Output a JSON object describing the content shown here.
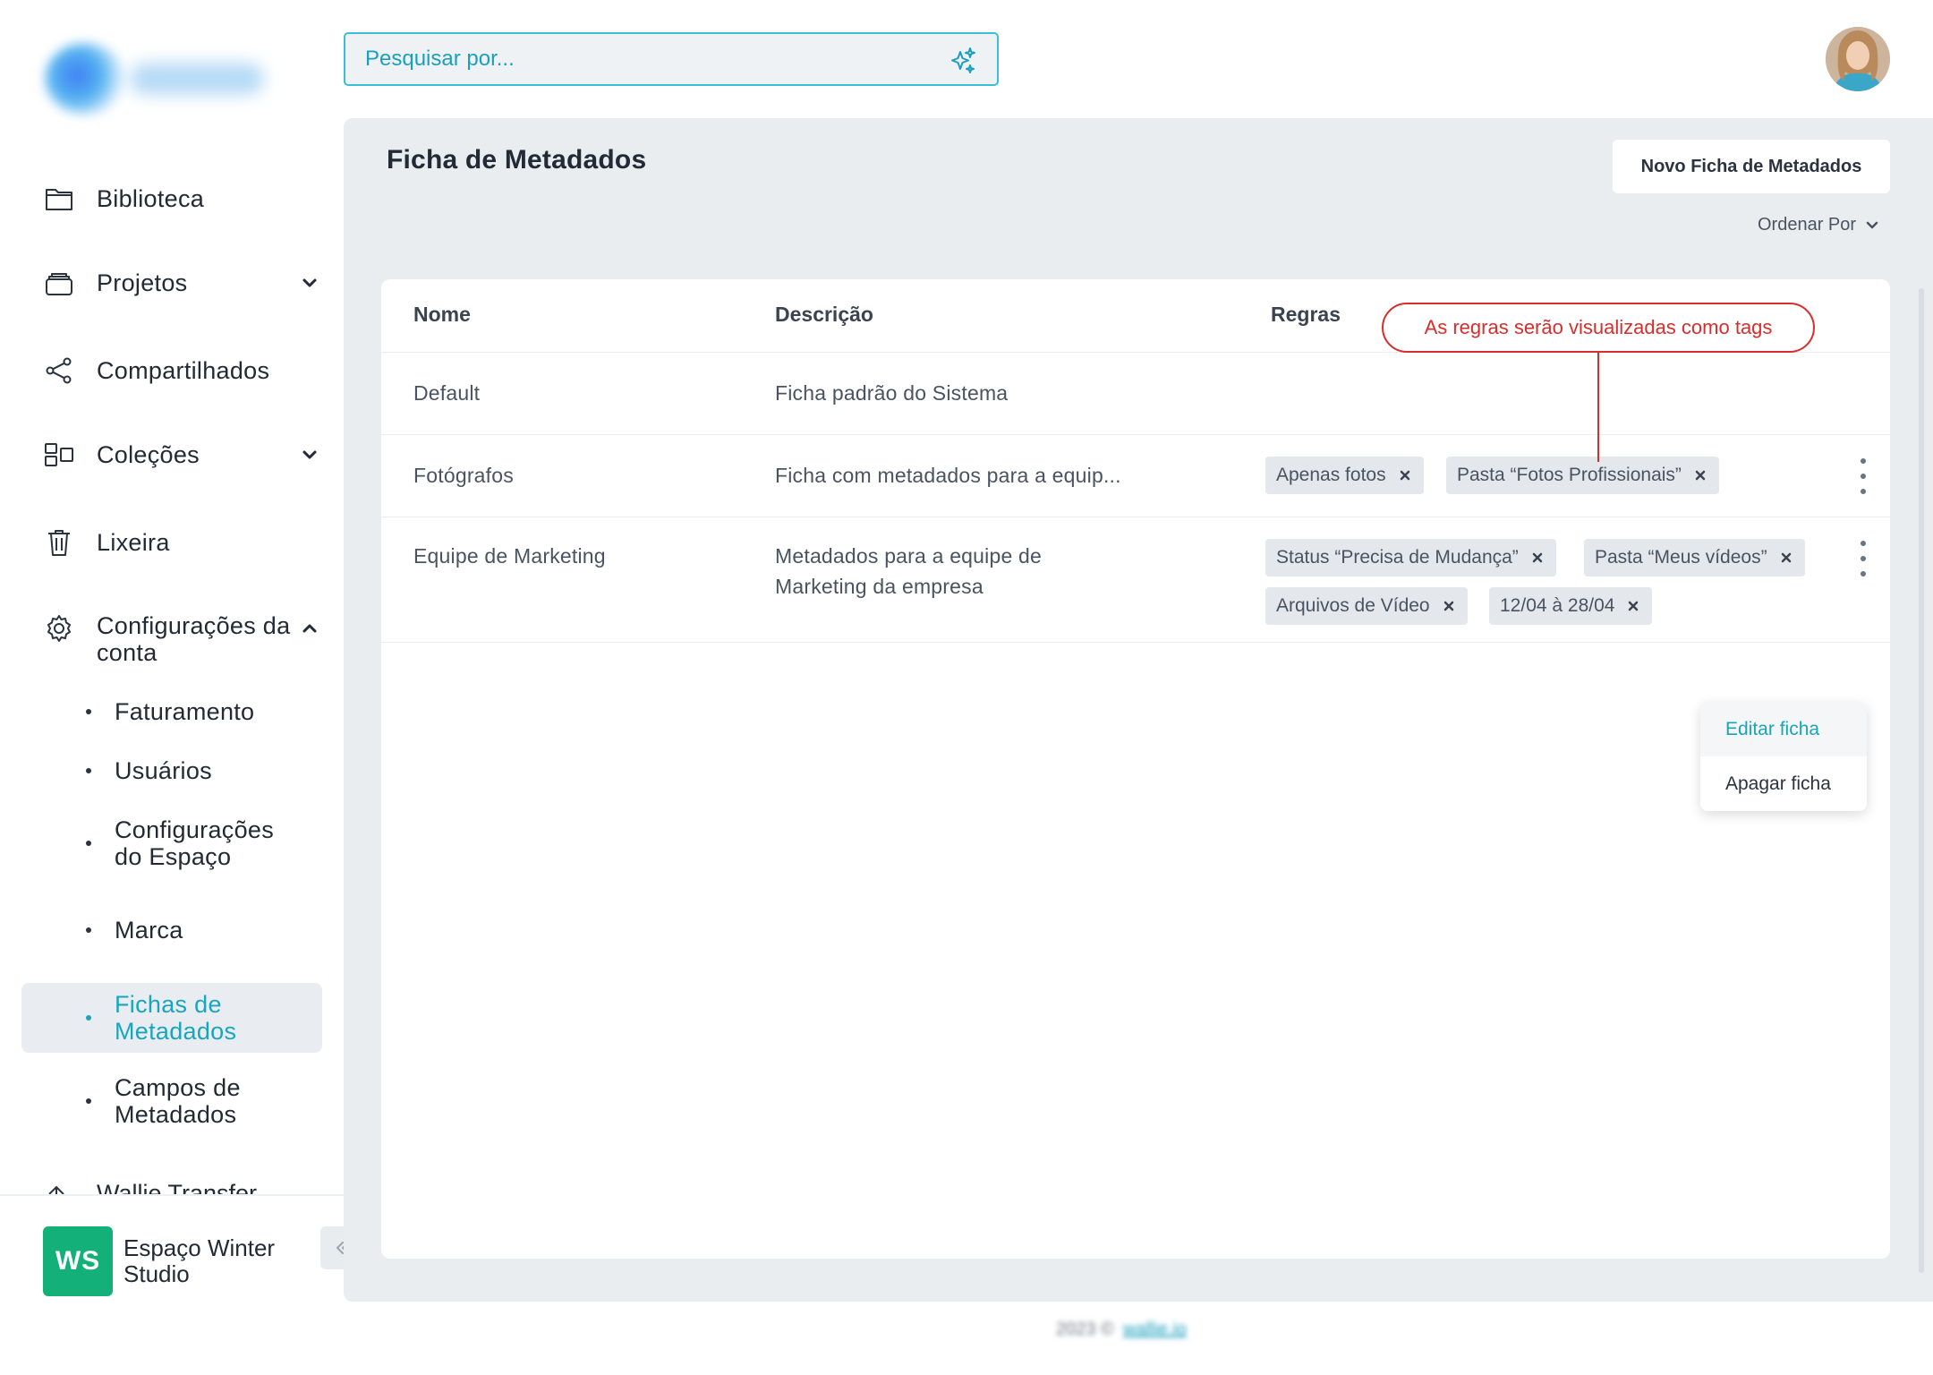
{
  "search": {
    "placeholder": "Pesquisar por..."
  },
  "sidebar": {
    "items": [
      {
        "label": "Biblioteca",
        "icon": "folder-icon"
      },
      {
        "label": "Projetos",
        "icon": "stack-icon"
      },
      {
        "label": "Compartilhados",
        "icon": "share-icon"
      },
      {
        "label": "Coleções",
        "icon": "collections-icon"
      },
      {
        "label": "Lixeira",
        "icon": "trash-icon"
      },
      {
        "label": "Configurações da conta",
        "icon": "gear-icon"
      }
    ],
    "subitems": [
      {
        "label": "Faturamento"
      },
      {
        "label": "Usuários"
      },
      {
        "label": "Configurações do Espaço"
      },
      {
        "label": "Marca"
      },
      {
        "label": "Fichas de Metadados",
        "active": true
      },
      {
        "label": "Campos de Metadados"
      }
    ],
    "cut_item_label": "Wallie Transfer",
    "workspace": {
      "initials": "WS",
      "name": "Espaço Winter Studio"
    }
  },
  "main": {
    "title": "Ficha de Metadados",
    "new_button": "Novo Ficha de Metadados",
    "sort_label": "Ordenar Por",
    "table": {
      "headers": [
        "Nome",
        "Descrição",
        "Regras"
      ],
      "rows": [
        {
          "name": "Default",
          "description": "Ficha padrão do Sistema",
          "tags": []
        },
        {
          "name": "Fotógrafos",
          "description": "Ficha com metadados para a equip...",
          "tags": [
            "Apenas fotos",
            "Pasta “Fotos Profissionais”"
          ]
        },
        {
          "name": "Equipe de Marketing",
          "description": "Metadados para a equipe de Marketing da empresa",
          "tags": [
            "Status “Precisa de Mudança”",
            "Pasta “Meus vídeos”",
            "Arquivos de Vídeo",
            "12/04 à 28/04"
          ]
        }
      ]
    },
    "callout": "As regras serão visualizadas como tags",
    "context_menu": [
      "Editar ficha",
      "Apagar ficha"
    ]
  },
  "footer": {
    "year": "2023 ©",
    "brand": "wallie.io"
  },
  "colors": {
    "accent": "#19a5bd",
    "workspace": "#13b07a",
    "callout": "#d92d2d",
    "panel": "#e9edf0"
  }
}
